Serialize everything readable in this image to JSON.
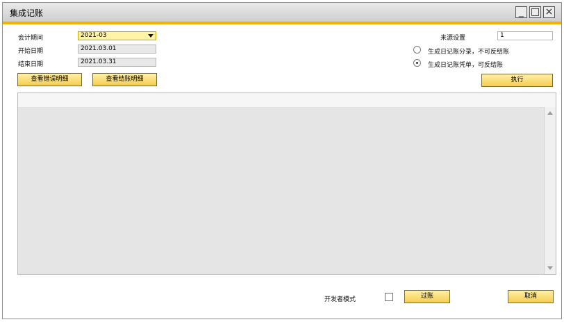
{
  "window": {
    "title": "集成记账"
  },
  "form": {
    "period_label": "会计期间",
    "period_value": "2021-03",
    "start_label": "开始日期",
    "start_value": "2021.03.01",
    "end_label": "结束日期",
    "end_value": "2021.03.31",
    "source_label": "来源设置",
    "source_value": "1"
  },
  "options": [
    {
      "label": "生成日记账分录，不可反结账",
      "selected": false
    },
    {
      "label": "生成日记账凭单，可反结账",
      "selected": true
    }
  ],
  "buttons": {
    "view_errors": "查看错误明细",
    "view_closing": "查看结账明细",
    "execute": "执行",
    "post": "过账",
    "cancel": "取消"
  },
  "footer": {
    "dev_mode_label": "开发者模式",
    "dev_mode_checked": false
  },
  "colors": {
    "accent": "#f2b300",
    "button": "#f5cd50"
  }
}
